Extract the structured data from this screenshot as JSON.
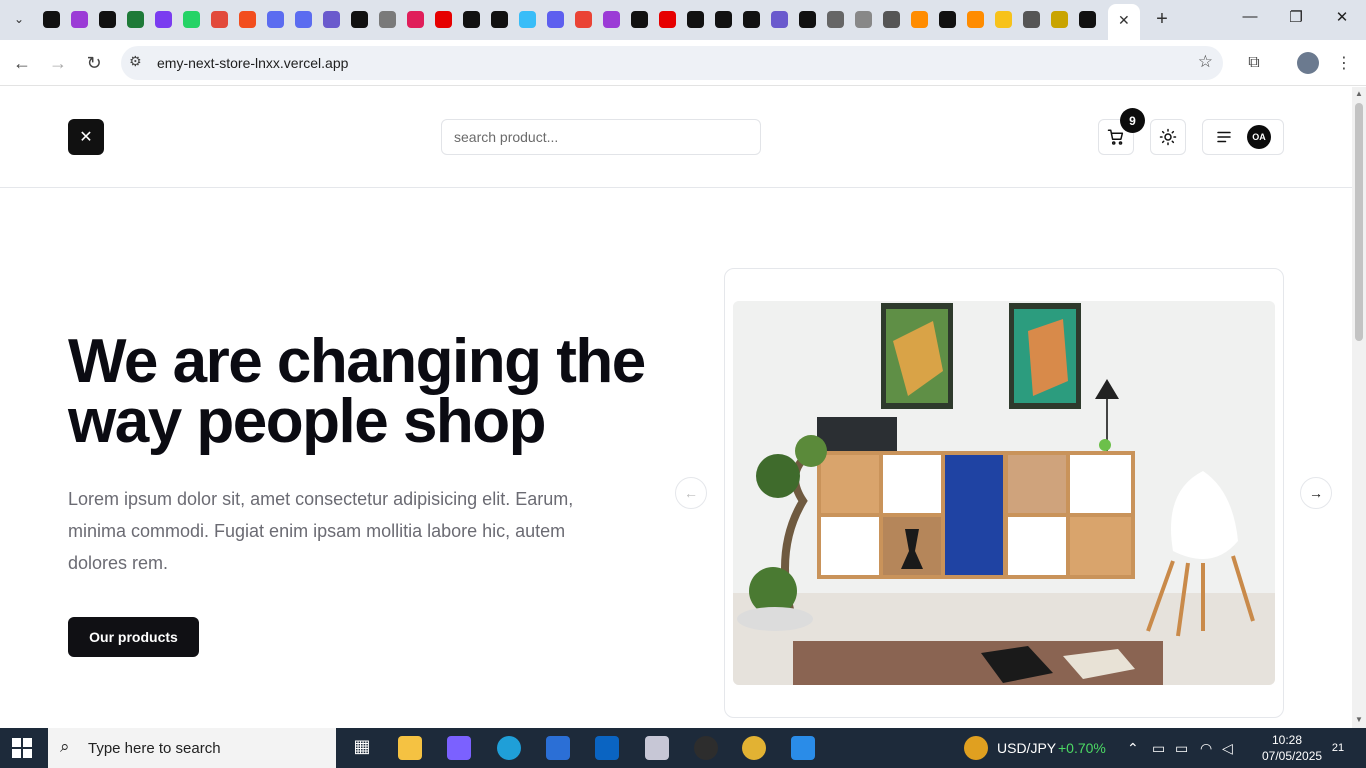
{
  "browser": {
    "url": "emy-next-store-lnxx.vercel.app",
    "favicon_colors": [
      "#111111",
      "#9b3bd6",
      "#111111",
      "#1e7a38",
      "#7a3cf0",
      "#25d366",
      "#e24a3b",
      "#f24e1e",
      "#5b6cf0",
      "#5b6cf0",
      "#6a5acd",
      "#111111",
      "#7a7a7a",
      "#e01e5a",
      "#e60000",
      "#111111",
      "#111111",
      "#38bdf8",
      "#5d5fef",
      "#ea4335",
      "#9b3bd6",
      "#111111",
      "#e60000",
      "#111111",
      "#111111",
      "#111111",
      "#6a5acd",
      "#111111",
      "#666666",
      "#888888",
      "#555555",
      "#ff8c00",
      "#111111",
      "#ff8c00",
      "#f7c21a",
      "#555555",
      "#c9a400",
      "#111111"
    ],
    "active_tab_close": "✕",
    "new_tab": "+"
  },
  "site": {
    "logo_glyph": "✕",
    "search_placeholder": "search product...",
    "cart_count": "9",
    "avatar_initials": "OA"
  },
  "hero": {
    "title": "We are changing the way people shop",
    "text": "Lorem ipsum dolor sit, amet consectetur adipisicing elit. Earum, minima commodi. Fugiat enim ipsam mollitia labore hic, autem dolores rem.",
    "cta": "Our products"
  },
  "taskbar": {
    "search_placeholder": "Type here to search",
    "ticker": "USD/JPY",
    "ticker_change": "+0.70%",
    "time": "10:28",
    "date": "07/05/2025",
    "notifications": "21"
  }
}
